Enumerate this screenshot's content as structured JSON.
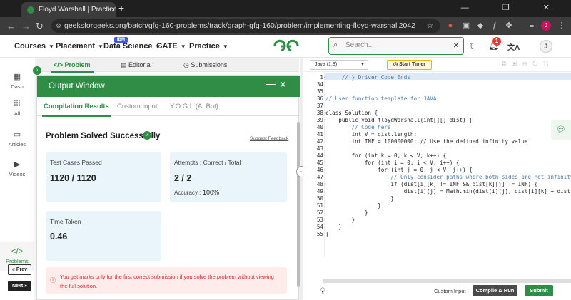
{
  "browser": {
    "tab_title": "Floyd Warshall | Practice | GeeksforGeeks",
    "tab_close": "×",
    "new_tab": "+",
    "url": "geeksforgeeks.org/batch/gfg-160-problems/track/graph-gfg-160/problem/implementing-floyd-warshall2042",
    "avatar_letter": "J",
    "window_controls": "— ❐ ✕"
  },
  "nav": {
    "courses": "Courses",
    "placement": "Placement",
    "data_science": "Data Science",
    "ibm_badge": "IBM",
    "gate": "GATE",
    "practice": "Practice",
    "logo": "GG",
    "search_placeholder": "Search...",
    "notification_count": "1",
    "user_initial": "J"
  },
  "sidebar": {
    "items": [
      {
        "label": "Dash",
        "icon": "dashboard-icon"
      },
      {
        "label": "All",
        "icon": "grid-icon"
      },
      {
        "label": "Articles",
        "icon": "book-icon"
      },
      {
        "label": "Videos",
        "icon": "video-icon"
      },
      {
        "label": "Problems",
        "icon": "code-icon"
      }
    ],
    "prev": "« Prev",
    "next": "Next »"
  },
  "problem_tabs": {
    "problem": "</> Problem",
    "editorial": "Editorial",
    "submissions": "Submissions"
  },
  "output_window": {
    "title": "Output Window",
    "tabs": [
      "Compilation Results",
      "Custom Input",
      "Y.O.G.I. (AI Bot)"
    ],
    "status": "Problem Solved Successfully",
    "feedback": "Suggest Feedback",
    "test_cases_label": "Test Cases Passed",
    "test_cases_value": "1120 / 1120",
    "attempts_label": "Attempts : Correct / Total",
    "attempts_value": "2 / 2",
    "accuracy_label": "Accuracy :",
    "accuracy_value": "100%",
    "time_label": "Time Taken",
    "time_value": "0.46",
    "warning": "You get marks only for the first correct submission if you solve the problem without viewing the full solution."
  },
  "editor": {
    "language": "Java (1.8)",
    "timer": "Start Timer",
    "custom_input": "Custom Input",
    "compile_run": "Compile & Run",
    "submit": "Submit",
    "lines": [
      {
        "n": "1",
        "text": "     // } Driver Code Ends",
        "cls": "cm",
        "fold": "▸"
      },
      {
        "n": "34",
        "text": ""
      },
      {
        "n": "35",
        "text": ""
      },
      {
        "n": "36",
        "text": "// User function template for JAVA",
        "cls": "cm"
      },
      {
        "n": "37",
        "text": ""
      },
      {
        "n": "38",
        "text": "class Solution {",
        "fold": "▾"
      },
      {
        "n": "39",
        "text": "    public void floydWarshall(int[][] dist) {",
        "fold": "▾"
      },
      {
        "n": "40",
        "text": "        // Code here",
        "cls": "cm"
      },
      {
        "n": "41",
        "text": "        int V = dist.length;"
      },
      {
        "n": "42",
        "text": "        int INF = 100000000; // Use the defined infinity value"
      },
      {
        "n": "43",
        "text": ""
      },
      {
        "n": "44",
        "text": "        for (int k = 0; k < V; k++) {",
        "fold": "▾"
      },
      {
        "n": "45",
        "text": "            for (int i = 0; i < V; i++) {",
        "fold": "▾"
      },
      {
        "n": "46",
        "text": "                for (int j = 0; j < V; j++) {",
        "fold": "▾"
      },
      {
        "n": "47",
        "text": "                    // Only consider paths where both sides are not infinity",
        "cls": "cm"
      },
      {
        "n": "48",
        "text": "                    if (dist[i][k] != INF && dist[k][j] != INF) {",
        "fold": "▾"
      },
      {
        "n": "49",
        "text": "                        dist[i][j] = Math.min(dist[i][j], dist[i][k] + dist[k][j]);"
      },
      {
        "n": "50",
        "text": "                    }"
      },
      {
        "n": "51",
        "text": "                }"
      },
      {
        "n": "52",
        "text": "            }"
      },
      {
        "n": "53",
        "text": "        }"
      },
      {
        "n": "54",
        "text": "    }"
      },
      {
        "n": "55",
        "text": "}"
      }
    ]
  },
  "colors": {
    "brand": "#2f8d46",
    "warning": "#d32f2f"
  }
}
